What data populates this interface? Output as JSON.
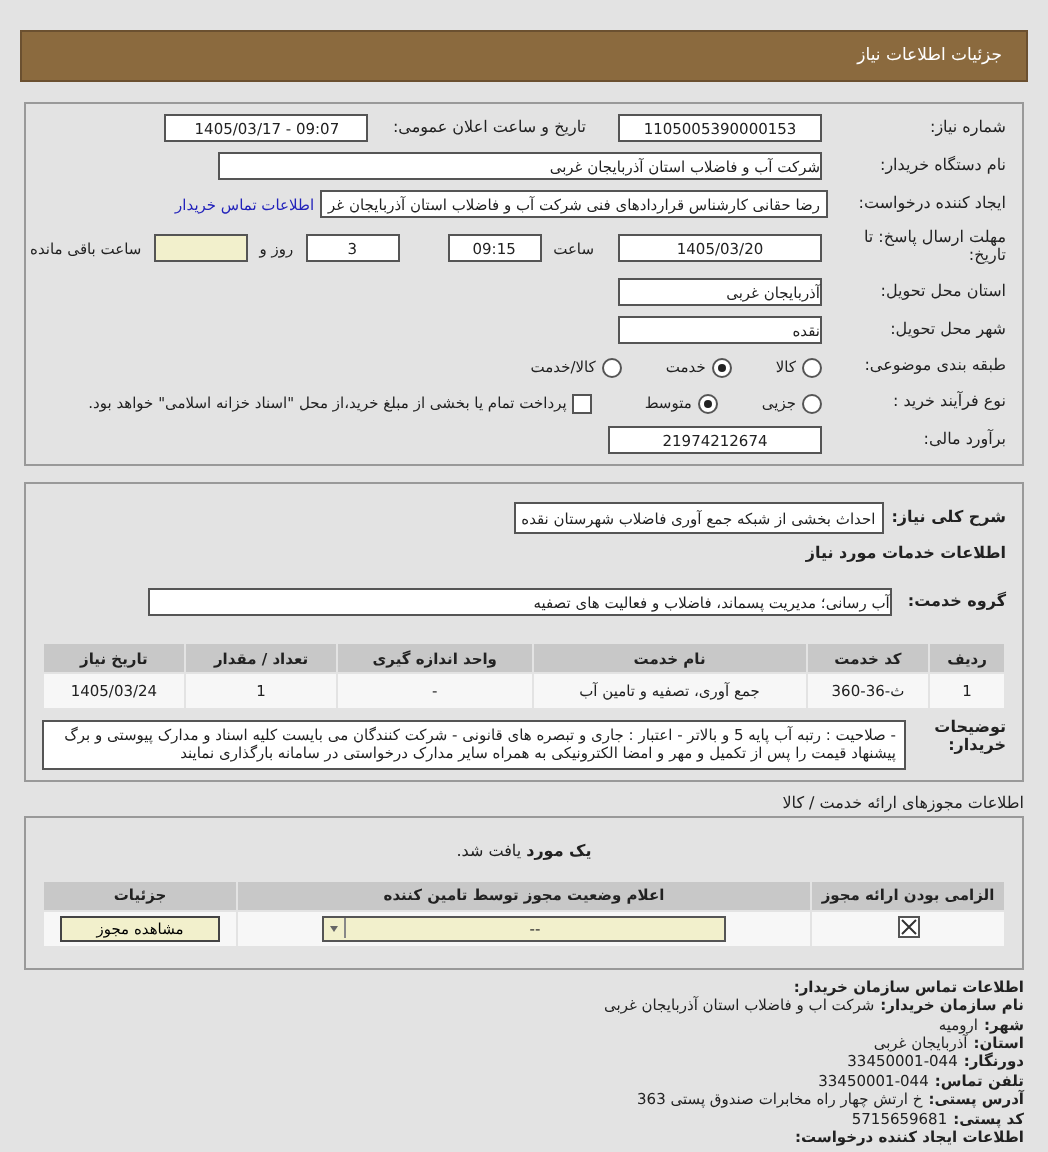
{
  "header": {
    "title": "جزئیات اطلاعات نیاز"
  },
  "need": {
    "number_label": "شماره نیاز:",
    "number": "1105005390000153",
    "announce_label": "تاریخ و ساعت اعلان عمومی:",
    "announce": "1405/03/17 - 09:07",
    "buyer_label": "نام دستگاه خریدار:",
    "buyer": "شرکت آب و فاضلاب استان آذربایجان غربی",
    "creator_label": "ایجاد کننده درخواست:",
    "creator": "رضا حقانی کارشناس قراردادهای فنی شرکت آب و فاضلاب استان آذربایجان غر",
    "contact_link": "اطلاعات تماس خریدار",
    "deadline": {
      "label": "مهلت ارسال پاسخ: تا تاریخ:",
      "date": "1405/03/20",
      "time_label": "ساعت",
      "time": "09:15",
      "days": "3",
      "days_label": "روز و",
      "hours_label": "ساعت باقی مانده"
    },
    "province_label": "استان محل تحویل:",
    "province": "آذربایجان غربی",
    "city_label": "شهر محل تحویل:",
    "city": "نقده",
    "category": {
      "label": "طبقه بندی موضوعی:",
      "options": [
        {
          "label": "کالا",
          "selected": false
        },
        {
          "label": "خدمت",
          "selected": true
        },
        {
          "label": "کالا/خدمت",
          "selected": false
        }
      ]
    },
    "process": {
      "label": "نوع فرآیند خرید :",
      "options": [
        {
          "label": "جزیی",
          "selected": false
        },
        {
          "label": "متوسط",
          "selected": true
        }
      ],
      "payment": {
        "checked": false,
        "text": "پرداخت تمام یا بخشی از مبلغ خرید،از محل \"اسناد خزانه اسلامی\" خواهد بود."
      }
    },
    "budget_label": "برآورد مالی:",
    "budget": "21974212674"
  },
  "services": {
    "description_label": "شرح کلی نیاز:",
    "description": "احداث بخشی از شبکه جمع آوری فاضلاب شهرستان نقده",
    "heading": "اطلاعات خدمات مورد نیاز",
    "group_label": "گروه خدمت:",
    "group": "آب رسانی؛ مدیریت پسماند، فاضلاب و فعالیت های تصفیه",
    "columns": [
      "ردیف",
      "کد خدمت",
      "نام خدمت",
      "واحد اندازه گیری",
      "تعداد / مقدار",
      "تاریخ نیاز"
    ],
    "rows": [
      [
        "1",
        "ث-36-360",
        "جمع آوری، تصفیه و تامین آب",
        "-",
        "1",
        "1405/03/24"
      ]
    ],
    "notes_label": "توضیحات خریدار:",
    "notes": "- صلاحیت : رتبه آب پایه 5 و بالاتر - اعتبار : جاری و تبصره های قانونی - شرکت کنندگان می بایست کلیه اسناد و مدارک پیوستی و برگ پیشنهاد قیمت را پس از تکمیل و مهر و امضا الکترونیکی به همراه سایر مدارک درخواستی در سامانه بارگذاری نمایند"
  },
  "licenses": {
    "heading": "اطلاعات مجوزهای ارائه خدمت / کالا",
    "found": "**یک مورد** یافت شد.",
    "columns": [
      "الزامی بودن ارائه مجوز",
      "اعلام وضعیت مجوز توسط تامین کننده",
      "جزئیات"
    ],
    "rows": [
      {
        "required": true,
        "status": "--",
        "button": "مشاهده مجوز"
      }
    ]
  },
  "contact": {
    "heading": "اطلاعات تماس سازمان خریدار:",
    "items": [
      {
        "label": "نام سازمان خریدار:",
        "value": "شرکت اب و فاضلاب استان آذربایجان غربی"
      },
      {
        "label": "شهر:",
        "value": "ارومیه"
      },
      {
        "label": "استان:",
        "value": "آذربایجان غربی"
      },
      {
        "label": "دورنگار:",
        "value": "33450001-044"
      },
      {
        "label": "تلفن تماس:",
        "value": "33450001-044"
      },
      {
        "label": "آدرس پستی:",
        "value": "خ ارتش چهار راه مخابرات صندوق پستی 363"
      },
      {
        "label": "کد پستی:",
        "value": "5715659681"
      }
    ],
    "footer": "اطلاعات ایجاد کننده درخواست:"
  }
}
